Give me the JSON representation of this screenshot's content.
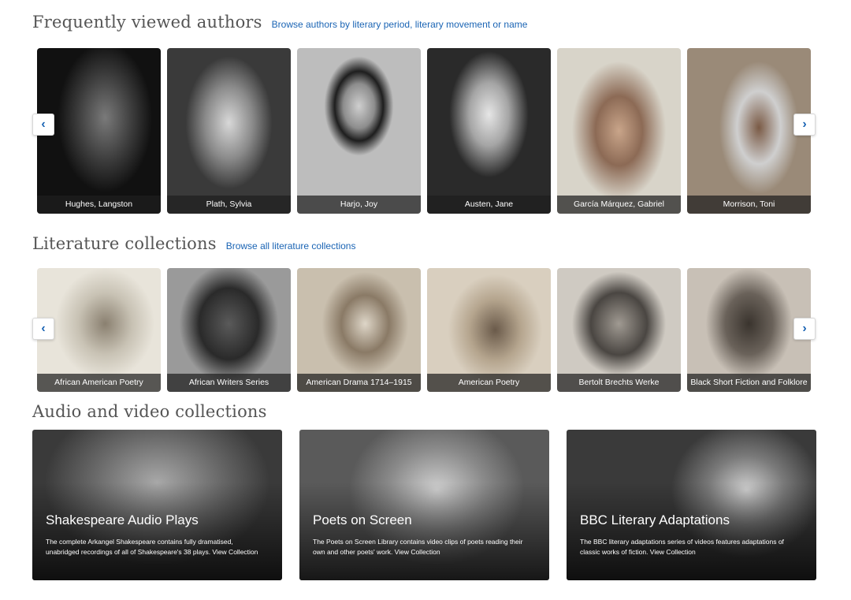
{
  "authors": {
    "title": "Frequently viewed authors",
    "link": "Browse authors by literary period, literary movement or name",
    "prev_icon": "chevron-left-icon",
    "next_icon": "chevron-right-icon",
    "items": [
      {
        "label": "Hughes, Langston"
      },
      {
        "label": "Plath, Sylvia"
      },
      {
        "label": "Harjo, Joy"
      },
      {
        "label": "Austen, Jane"
      },
      {
        "label": "García Márquez, Gabriel"
      },
      {
        "label": "Morrison, Toni"
      }
    ]
  },
  "collections": {
    "title": "Literature collections",
    "link": "Browse all literature collections",
    "items": [
      {
        "label": "African American Poetry"
      },
      {
        "label": "African Writers Series"
      },
      {
        "label": "American Drama 1714–1915"
      },
      {
        "label": "American Poetry"
      },
      {
        "label": "Bertolt Brechts Werke"
      },
      {
        "label": "Black Short Fiction and Folklore"
      }
    ]
  },
  "media": {
    "title": "Audio and video collections",
    "items": [
      {
        "title": "Shakespeare Audio Plays",
        "desc": "The complete Arkangel Shakespeare contains fully dramatised, unabridged recordings of all of Shakespeare's 38 plays. View Collection"
      },
      {
        "title": "Poets on Screen",
        "desc": "The Poets on Screen Library contains video clips of poets reading their own and other poets' work. View Collection"
      },
      {
        "title": "BBC Literary Adaptations",
        "desc": "The BBC literary adaptations series of videos features adaptations of classic works of fiction. View Collection"
      }
    ]
  },
  "colors": {
    "link": "#1a64b4",
    "caption_bg": "#1e1e1e"
  }
}
